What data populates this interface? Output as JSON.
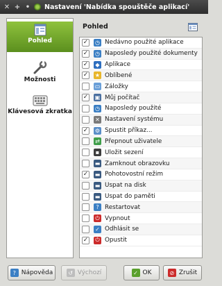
{
  "window": {
    "title": "Nastavení 'Nabídka spouštěče aplikací'",
    "btn_close_glyph": "✕",
    "btn_plus_glyph": "+",
    "btn_pin_glyph": "•"
  },
  "nav": {
    "items": [
      {
        "label": "Pohled",
        "icon": "layout-icon",
        "active": true
      },
      {
        "label": "Možnosti",
        "icon": "wrench-icon",
        "active": false
      },
      {
        "label": "Klávesová zkratka",
        "icon": "keyboard-icon",
        "active": false
      }
    ]
  },
  "panel": {
    "title": "Pohled"
  },
  "list": [
    {
      "label": "Nedávno použité aplikace",
      "checked": true,
      "icon": "recent-apps-icon",
      "color": "#3b7fc4",
      "glyph": "◷"
    },
    {
      "label": "Naposledy použité dokumenty",
      "checked": true,
      "icon": "recent-docs-icon",
      "color": "#3b7fc4",
      "glyph": "◷"
    },
    {
      "label": "Aplikace",
      "checked": true,
      "icon": "applications-icon",
      "color": "#2f6fbf",
      "glyph": "◆"
    },
    {
      "label": "Oblíbené",
      "checked": true,
      "icon": "favorites-icon",
      "color": "#e8b62c",
      "glyph": "★"
    },
    {
      "label": "Záložky",
      "checked": false,
      "icon": "bookmarks-icon",
      "color": "#6a9fd8",
      "glyph": "▭"
    },
    {
      "label": "Můj počítač",
      "checked": true,
      "icon": "computer-icon",
      "color": "#4a6fa0",
      "glyph": "▣"
    },
    {
      "label": "Naposledy použité",
      "checked": false,
      "icon": "recent-icon",
      "color": "#3b7fc4",
      "glyph": "◷"
    },
    {
      "label": "Nastavení systému",
      "checked": false,
      "icon": "system-settings-icon",
      "color": "#7a7a7a",
      "glyph": "✕"
    },
    {
      "label": "Spustit příkaz...",
      "checked": true,
      "icon": "run-command-icon",
      "color": "#5a8ec8",
      "glyph": "⚙"
    },
    {
      "label": "Přepnout uživatele",
      "checked": false,
      "icon": "switch-user-icon",
      "color": "#3f9e4a",
      "glyph": "⇄"
    },
    {
      "label": "Uložit sezení",
      "checked": false,
      "icon": "save-session-icon",
      "color": "#3e3e3e",
      "glyph": "▪"
    },
    {
      "label": "Zamknout obrazovku",
      "checked": false,
      "icon": "lock-screen-icon",
      "color": "#3a5a80",
      "glyph": "▬"
    },
    {
      "label": "Pohotovostní režim",
      "checked": true,
      "icon": "standby-icon",
      "color": "#3a5a80",
      "glyph": "▬"
    },
    {
      "label": "Uspat na disk",
      "checked": false,
      "icon": "suspend-disk-icon",
      "color": "#3a5a80",
      "glyph": "▬"
    },
    {
      "label": "Uspat do paměti",
      "checked": false,
      "icon": "suspend-ram-icon",
      "color": "#3a5a80",
      "glyph": "▬"
    },
    {
      "label": "Restartovat",
      "checked": false,
      "icon": "restart-icon",
      "color": "#3b7fc4",
      "glyph": "?"
    },
    {
      "label": "Vypnout",
      "checked": false,
      "icon": "shutdown-icon",
      "color": "#cc2b2b",
      "glyph": "⏻"
    },
    {
      "label": "Odhlásit se",
      "checked": false,
      "icon": "logout-icon",
      "color": "#3b7fc4",
      "glyph": "✓"
    },
    {
      "label": "Opustit",
      "checked": true,
      "icon": "quit-icon",
      "color": "#cc2b2b",
      "glyph": "⏻"
    }
  ],
  "buttons": {
    "help": "Nápověda",
    "defaults": "Výchozí",
    "ok": "OK",
    "cancel": "Zrušit"
  }
}
